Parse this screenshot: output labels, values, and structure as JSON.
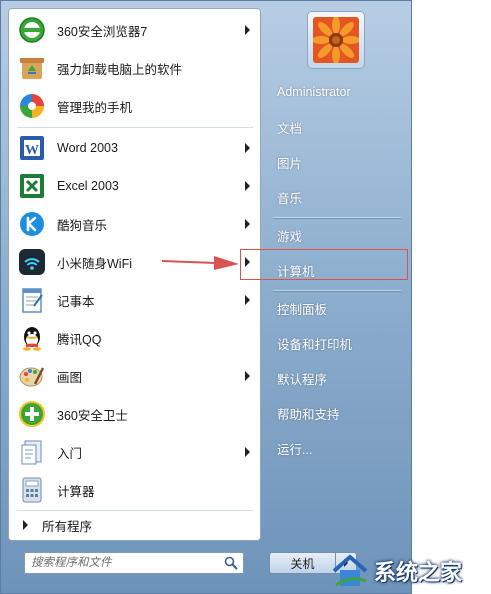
{
  "programs": [
    {
      "label": "360安全浏览器7",
      "icon": "browser-360-icon",
      "submenu": true
    },
    {
      "label": "强力卸载电脑上的软件",
      "icon": "uninstaller-icon",
      "submenu": false
    },
    {
      "label": "管理我的手机",
      "icon": "phone-manager-icon",
      "submenu": false
    },
    {
      "label": "Word 2003",
      "icon": "word-icon",
      "submenu": true
    },
    {
      "label": "Excel 2003",
      "icon": "excel-icon",
      "submenu": true
    },
    {
      "label": "酷狗音乐",
      "icon": "kugou-icon",
      "submenu": true
    },
    {
      "label": "小米随身WiFi",
      "icon": "wifi-icon",
      "submenu": true
    },
    {
      "label": "记事本",
      "icon": "notepad-icon",
      "submenu": true
    },
    {
      "label": "腾讯QQ",
      "icon": "qq-icon",
      "submenu": false
    },
    {
      "label": "画图",
      "icon": "paint-icon",
      "submenu": true
    },
    {
      "label": "360安全卫士",
      "icon": "security-360-icon",
      "submenu": false
    },
    {
      "label": "入门",
      "icon": "getting-started-icon",
      "submenu": true
    },
    {
      "label": "计算器",
      "icon": "calculator-icon",
      "submenu": false
    }
  ],
  "all_programs": "所有程序",
  "search": {
    "placeholder": "搜索程序和文件"
  },
  "right_pane": {
    "user": "Administrator",
    "items": [
      "文档",
      "图片",
      "音乐",
      "游戏",
      "计算机",
      "控制面板",
      "设备和打印机",
      "默认程序",
      "帮助和支持",
      "运行..."
    ],
    "highlighted": "计算机"
  },
  "shutdown": {
    "label": "关机"
  },
  "watermark": {
    "text": "系统之家"
  },
  "colors": {
    "highlight_border": "#d9534f",
    "menu_blue": "#8fb0cf"
  }
}
